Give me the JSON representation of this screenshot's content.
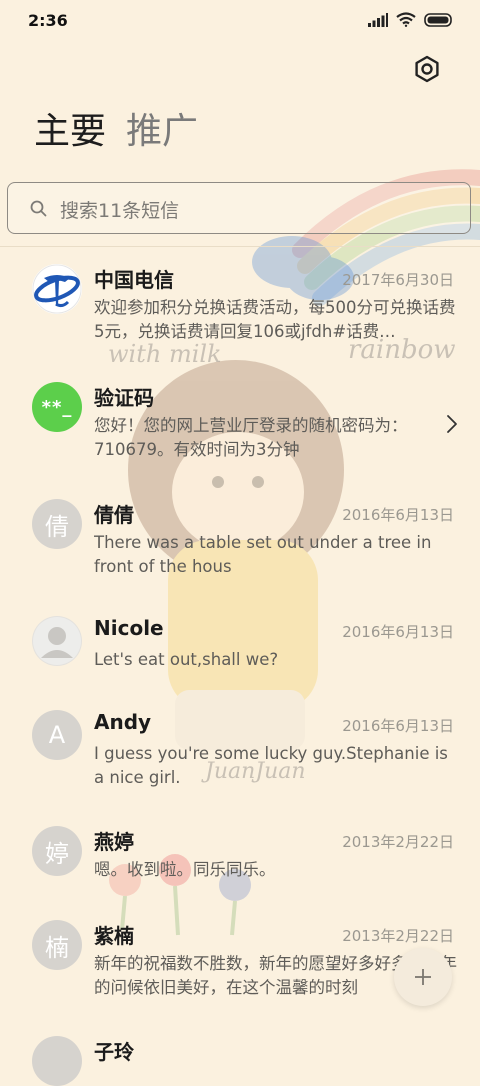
{
  "status_bar": {
    "time": "2:36"
  },
  "tabs": [
    {
      "label": "主要"
    },
    {
      "label": "推广"
    }
  ],
  "search": {
    "placeholder": "搜索11条短信"
  },
  "conversations": [
    {
      "name": "中国电信",
      "date": "2017年6月30日",
      "preview": "欢迎参加积分兑换话费活动，每500分可兑换话费5元，兑换话费请回复106或jfdh#话费…",
      "avatar": "telecom-logo"
    },
    {
      "name": "验证码",
      "date": "",
      "preview": "您好！您的网上营业厅登录的随机密码为：710679。有效时间为3分钟",
      "avatar_text": "**_"
    },
    {
      "name": "倩倩",
      "date": "2016年6月13日",
      "preview": "There was a table set out under a tree in front of the hous",
      "avatar_text": "倩"
    },
    {
      "name": "Nicole",
      "date": "2016年6月13日",
      "preview": "Let's eat out,shall we?",
      "avatar": "person-silhouette"
    },
    {
      "name": "Andy",
      "date": "2016年6月13日",
      "preview": "I guess you're some lucky guy.Stephanie is a nice girl.",
      "avatar_text": "A"
    },
    {
      "name": "燕婷",
      "date": "2013年2月22日",
      "preview": "嗯。收到啦。同乐同乐。",
      "avatar_text": "婷"
    },
    {
      "name": "紫楠",
      "date": "2013年2月22日",
      "preview": "新年的祝福数不胜数，新年的愿望好多好多，新年的问候依旧美好，在这个温馨的时刻",
      "avatar_text": "楠"
    },
    {
      "name": "子玲",
      "date": "",
      "preview": "",
      "avatar_text": ""
    }
  ],
  "wallpaper_text": [
    "with milk",
    "rainbow",
    "JuanJuan"
  ],
  "colors": {
    "background": "#fbf1df",
    "verify_avatar": "#5ccf4b",
    "telecom_blue": "#1f57b5"
  }
}
